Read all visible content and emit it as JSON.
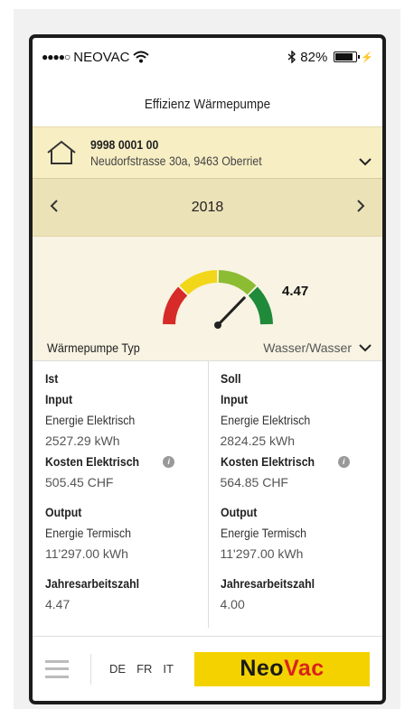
{
  "status_bar": {
    "carrier": "NEOVAC",
    "battery": "82%"
  },
  "header": {
    "title": "Effizienz Wärmepumpe"
  },
  "property": {
    "number": "9998 0001 00",
    "address": "Neudorfstrasse 30a, 9463 Oberriet"
  },
  "year_selector": {
    "year": "2018"
  },
  "gauge": {
    "value": "4.47",
    "level": 4.47,
    "segment_colors": [
      "#d62b28",
      "#f2d619",
      "#8cbc32",
      "#1f8a3a"
    ]
  },
  "pump_type": {
    "label": "Wärmepumpe Typ",
    "value": "Wasser/Wasser"
  },
  "ist": {
    "heading": "Ist",
    "input_label": "Input",
    "energie_elektrisch_label": "Energie Elektrisch",
    "energie_elektrisch_value": "2527.29 kWh",
    "kosten_label": "Kosten Elektrisch",
    "kosten_value": "505.45 CHF",
    "output_label": "Output",
    "energie_termisch_label": "Energie Termisch",
    "energie_termisch_value": "11'297.00 kWh",
    "jaz_label": "Jahresarbeitszahl",
    "jaz_value": "4.47"
  },
  "soll": {
    "heading": "Soll",
    "input_label": "Input",
    "energie_elektrisch_label": "Energie Elektrisch",
    "energie_elektrisch_value": "2824.25 kWh",
    "kosten_label": "Kosten Elektrisch",
    "kosten_value": "564.85 CHF",
    "output_label": "Output",
    "energie_termisch_label": "Energie Termisch",
    "energie_termisch_value": "11'297.00 kWh",
    "jaz_label": "Jahresarbeitszahl",
    "jaz_value": "4.00"
  },
  "footer": {
    "languages": [
      "DE",
      "FR",
      "IT"
    ],
    "logo_part1": "Neo",
    "logo_part2": "Vac",
    "logo_bg": "#f4d200",
    "logo_accent": "#d8241d"
  }
}
